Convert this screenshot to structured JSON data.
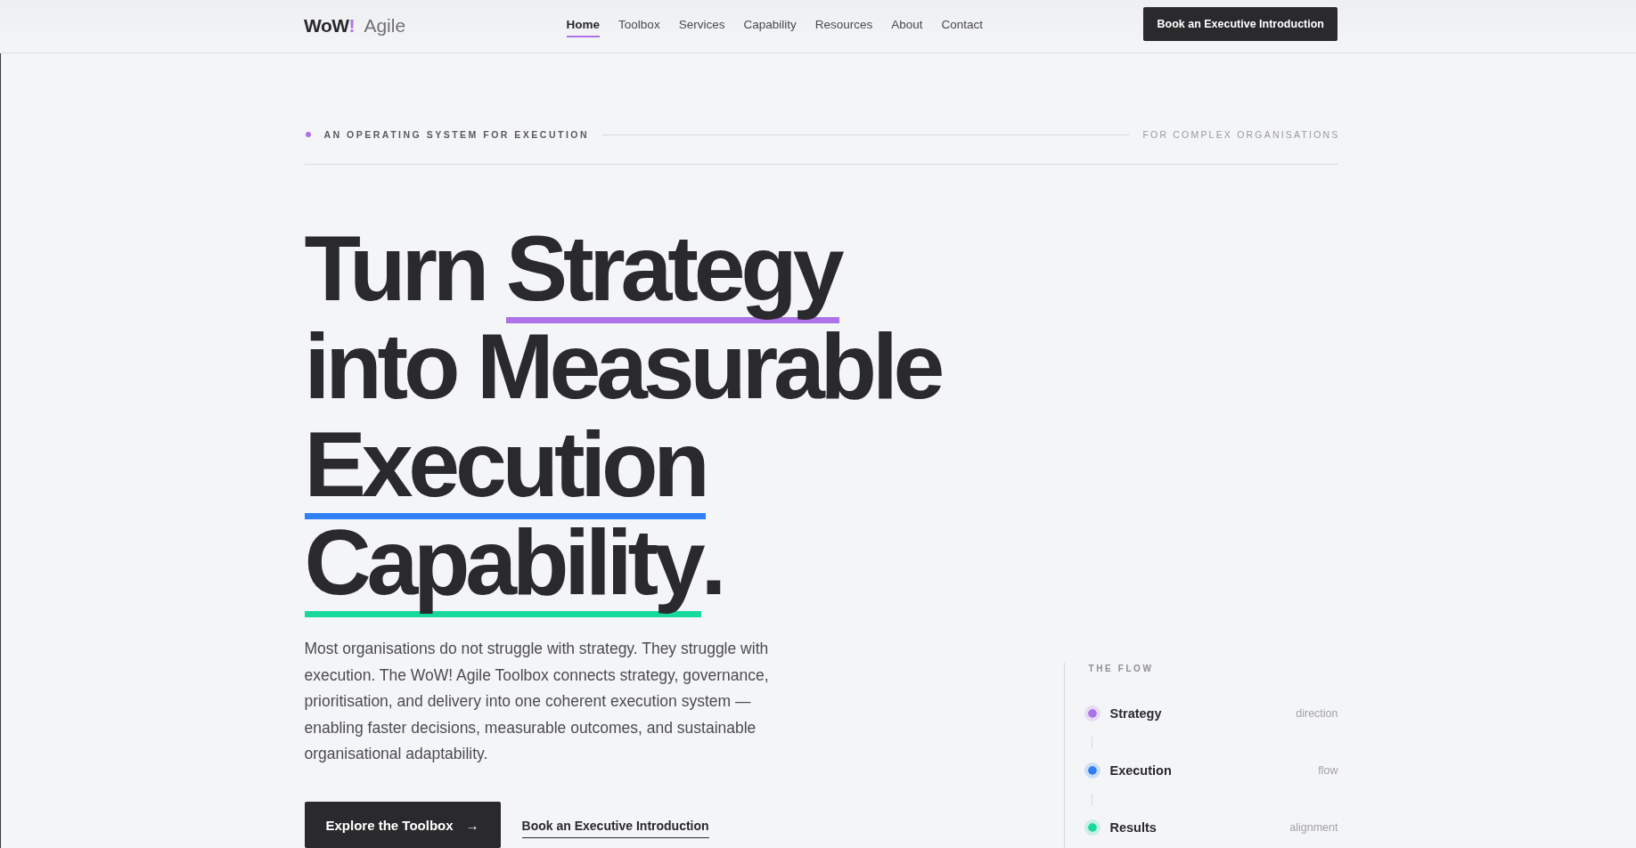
{
  "header": {
    "logo": {
      "name": "WoW",
      "mark": "!",
      "suffix": "Agile"
    },
    "nav": [
      {
        "label": "Home",
        "selected": true
      },
      {
        "label": "Toolbox",
        "selected": false
      },
      {
        "label": "Services",
        "selected": false
      },
      {
        "label": "Capability",
        "selected": false
      },
      {
        "label": "Resources",
        "selected": false
      },
      {
        "label": "About",
        "selected": false
      },
      {
        "label": "Contact",
        "selected": false
      }
    ],
    "cta": "Book an Executive Introduction"
  },
  "hero": {
    "eyebrow": {
      "label": "AN OPERATING SYSTEM FOR EXECUTION",
      "aside": "FOR COMPLEX ORGANISATIONS"
    },
    "headline": {
      "lines": [
        {
          "segments": [
            {
              "text": "Turn ",
              "underlined": false
            },
            {
              "text": "Strategy",
              "underlined": true,
              "color": "#ad72e8"
            }
          ]
        },
        {
          "segments": [
            {
              "text": "into Measurable",
              "underlined": false
            }
          ]
        },
        {
          "segments": [
            {
              "text": "Execution",
              "underlined": true,
              "color": "#2f7ff5"
            }
          ]
        },
        {
          "segments": [
            {
              "text": "Capability",
              "underlined": true,
              "color": "#17d99a"
            },
            {
              "text": ".",
              "underlined": false
            }
          ]
        }
      ]
    },
    "description": "Most organisations do not struggle with strategy. They struggle with execution. The WoW! Agile Toolbox connects strategy, governance, prioritisation, and delivery into one coherent execution system — enabling faster decisions, measurable outcomes, and sustainable organisational adaptability.",
    "actions": [
      {
        "kind": "button",
        "label": "Explore the Toolbox",
        "icon": "→"
      },
      {
        "kind": "link",
        "label": "Book an Executive Introduction"
      }
    ]
  },
  "flow": {
    "title": "THE FLOW",
    "steps": [
      {
        "label": "Strategy",
        "note": "direction",
        "color": "#ad72e8"
      },
      {
        "label": "Execution",
        "note": "flow",
        "color": "#2f7ff5"
      },
      {
        "label": "Results",
        "note": "alignment",
        "color": "#17d99a"
      }
    ]
  }
}
